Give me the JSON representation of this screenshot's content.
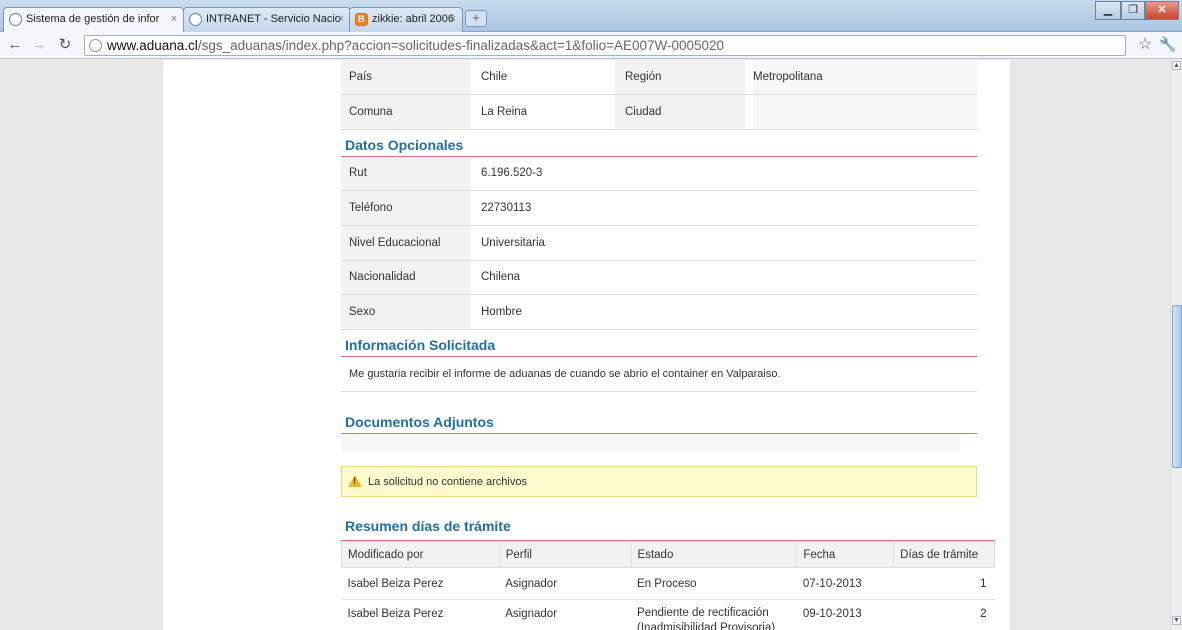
{
  "browser": {
    "tabs": [
      {
        "title": "Sistema de gestión de infor",
        "active": true,
        "icon": "globe-icon"
      },
      {
        "title": "INTRANET - Servicio Nacio",
        "active": false,
        "icon": "globe-icon"
      },
      {
        "title": "zikkie: abril 2006",
        "active": false,
        "icon": "blogger-icon"
      }
    ],
    "tab_close": "×",
    "url_host": "www.aduana.cl",
    "url_path": "/sgs_aduanas/index.php?accion=solicitudes-finalizadas&act=1&folio=AE007W-0005020"
  },
  "location_rows": [
    {
      "label": "País",
      "value": "Chile",
      "label2": "Región",
      "value2": "Metropolitana"
    },
    {
      "label": "Comuna",
      "value": "La Reina",
      "label2": "Ciudad",
      "value2": ""
    }
  ],
  "optional": {
    "heading": "Datos Opcionales",
    "rows": [
      {
        "label": "Rut",
        "value": "6.196.520-3"
      },
      {
        "label": "Teléfono",
        "value": "22730113"
      },
      {
        "label": "Nivel Educacional",
        "value": "Universitaria"
      },
      {
        "label": "Nacionalidad",
        "value": "Chilena"
      },
      {
        "label": "Sexo",
        "value": "Hombre"
      }
    ]
  },
  "requested": {
    "heading": "Información Solicitada",
    "text": "Me gustaria recibir el informe de aduanas de cuando se abrio el container en Valparaiso."
  },
  "attachments": {
    "heading": "Documentos Adjuntos",
    "alert": "La solicitud no contiene archivos"
  },
  "summary": {
    "heading": "Resumen días de trámite",
    "columns": [
      "Modificado por",
      "Perfil",
      "Estado",
      "Fecha",
      "Días de trámite"
    ],
    "rows": [
      {
        "by": "Isabel Beiza Perez",
        "profile": "Asignador",
        "status": "En Proceso",
        "status2": "",
        "date": "07-10-2013",
        "days": "1"
      },
      {
        "by": "Isabel Beiza Perez",
        "profile": "Asignador",
        "status": "Pendiente de rectificación",
        "status2": "(Inadmisibilidad Provisoria)",
        "date": "09-10-2013",
        "days": "2"
      }
    ]
  }
}
